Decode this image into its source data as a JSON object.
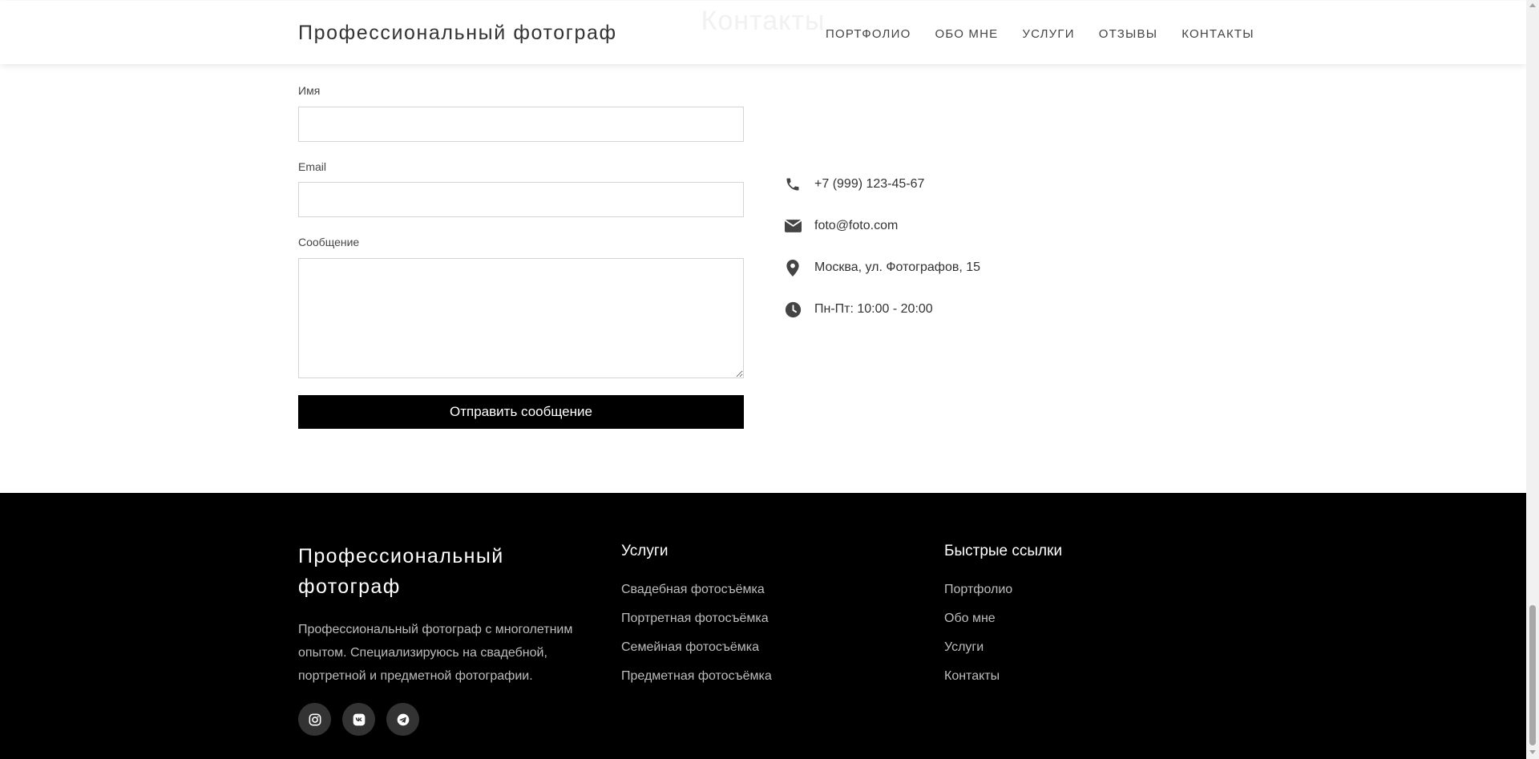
{
  "header": {
    "logo": "Профессиональный фотограф",
    "ghost_title": "Контакты",
    "nav": [
      "Портфолио",
      "Обо мне",
      "Услуги",
      "Отзывы",
      "Контакты"
    ]
  },
  "form": {
    "name_label": "Имя",
    "name_value": "",
    "email_label": "Email",
    "email_value": "",
    "message_label": "Сообщение",
    "message_value": "",
    "submit_label": "Отправить сообщение"
  },
  "contacts": [
    {
      "icon": "phone-icon",
      "text": "+7 (999) 123-45-67"
    },
    {
      "icon": "envelope-icon",
      "text": "foto@foto.com"
    },
    {
      "icon": "map-pin-icon",
      "text": "Москва, ул. Фотографов, 15"
    },
    {
      "icon": "clock-icon",
      "text": "Пн-Пт: 10:00 - 20:00"
    }
  ],
  "footer": {
    "brand": "Профессиональный фотограф",
    "description": "Профессиональный фотограф с многолетним опытом. Специализируюсь на свадебной, портретной и предметной фотографии.",
    "services_title": "Услуги",
    "services": [
      "Свадебная фотосъёмка",
      "Портретная фотосъёмка",
      "Семейная фотосъёмка",
      "Предметная фотосъёмка"
    ],
    "links_title": "Быстрые ссылки",
    "links": [
      "Портфолио",
      "Обо мне",
      "Услуги",
      "Контакты"
    ],
    "socials": [
      "instagram-icon",
      "vk-icon",
      "telegram-icon"
    ]
  },
  "colors": {
    "accent": "#000000",
    "footer_text": "#bdbdbd",
    "social_bg": "#333333"
  }
}
